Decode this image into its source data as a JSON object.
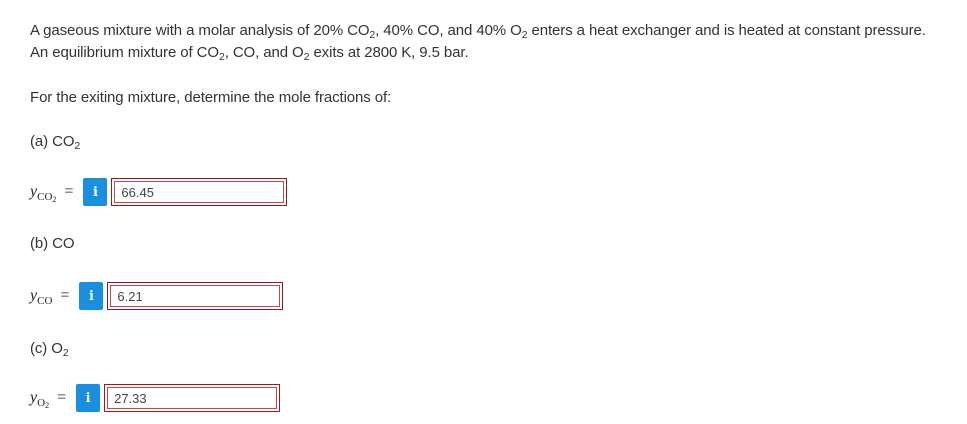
{
  "problem": {
    "line1_a": "A gaseous mixture with a molar analysis of 20% CO",
    "line1_b": ", 40% CO, and 40% O",
    "line1_c": " enters a heat exchanger and is heated at constant pressure.",
    "line2_a": "An equilibrium mixture of CO",
    "line2_b": ", CO, and O",
    "line2_c": " exits at 2800 K, 9.5 bar.",
    "prompt": "For the exiting mixture, determine the mole fractions of:",
    "subscript_2": "2"
  },
  "parts": [
    {
      "label_prefix": "(a) CO",
      "label_sub": "2",
      "var_letter": "y",
      "var_sub": "CO",
      "var_sub_sub": "2",
      "equals": "=",
      "info_icon": "i",
      "answer": "66.45"
    },
    {
      "label_prefix": "(b) CO",
      "label_sub": "",
      "var_letter": "y",
      "var_sub": "CO",
      "var_sub_sub": "",
      "equals": "=",
      "info_icon": "i",
      "answer": "6.21"
    },
    {
      "label_prefix": "(c) O",
      "label_sub": "2",
      "var_letter": "y",
      "var_sub": "O",
      "var_sub_sub": "2",
      "equals": "=",
      "info_icon": "i",
      "answer": "27.33"
    }
  ],
  "colors": {
    "info_button": "#1a8fe0",
    "answer_border_outer": "#9a1b1b",
    "answer_border_inner": "#c04a4a",
    "text": "#333333"
  }
}
